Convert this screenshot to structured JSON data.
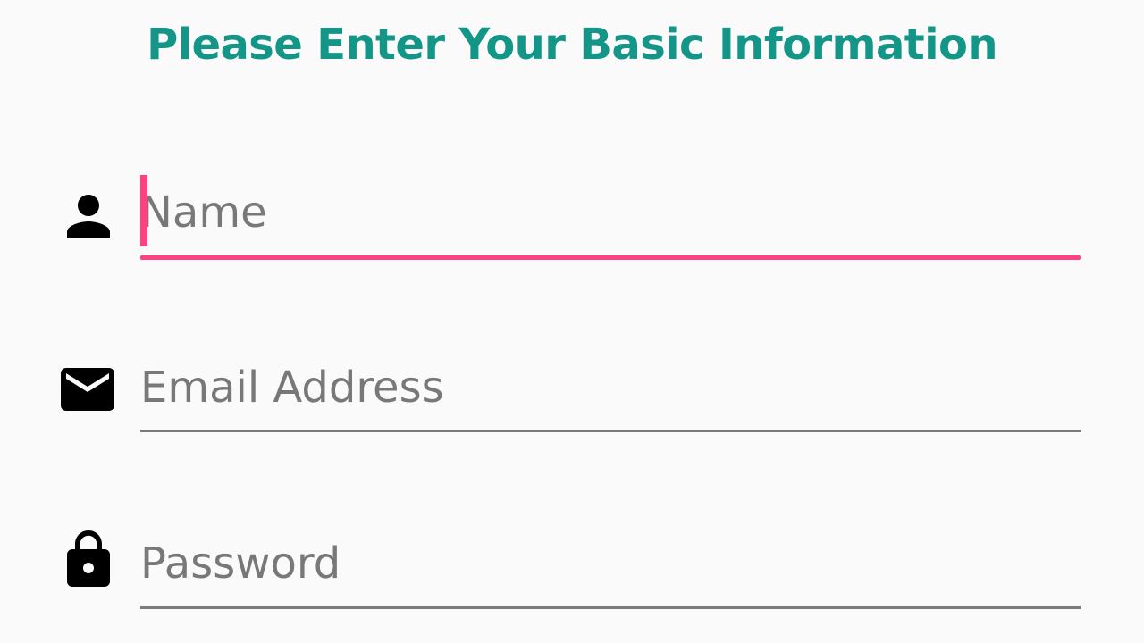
{
  "header": {
    "title": "Please Enter Your Basic Information"
  },
  "form": {
    "name": {
      "placeholder": "Name",
      "value": "",
      "icon": "person-icon",
      "focused": true
    },
    "email": {
      "placeholder": "Email Address",
      "value": "",
      "icon": "mail-icon"
    },
    "password": {
      "placeholder": "Password",
      "value": "",
      "icon": "lock-icon"
    }
  },
  "colors": {
    "title": "#139688",
    "accent": "#ff4081",
    "underline": "#7a7a7a",
    "placeholder": "#787878",
    "background": "#fafafa"
  }
}
